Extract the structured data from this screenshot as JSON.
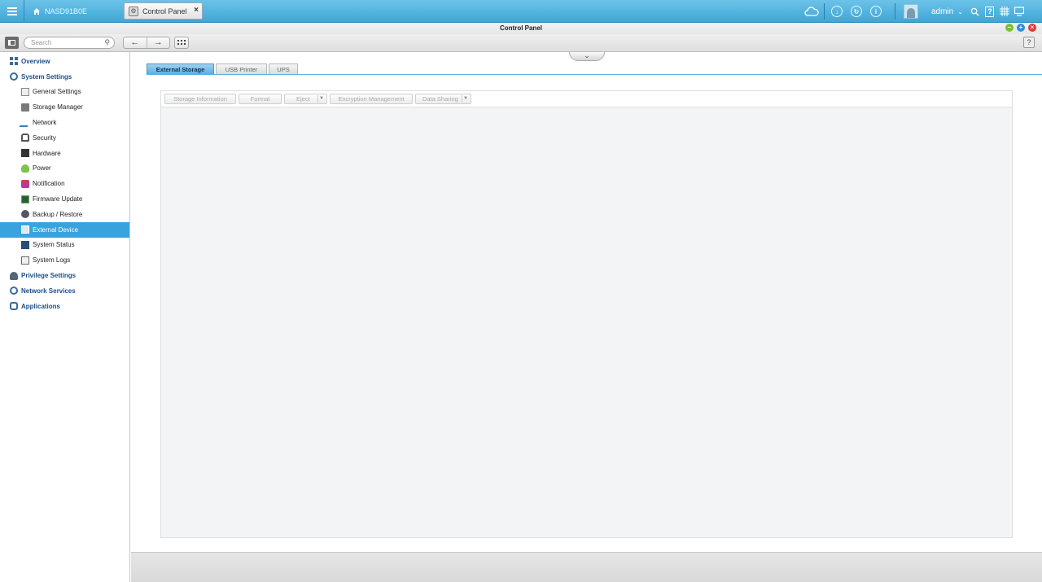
{
  "topbar": {
    "nas_name": "NASD91B0E",
    "app_tab_label": "Control Panel",
    "user_name": "admin",
    "icons": [
      "menu-icon",
      "home-icon",
      "cloud-icon",
      "download-icon",
      "sync-icon",
      "info-icon",
      "avatar-icon",
      "search-icon",
      "help-icon",
      "grid-icon",
      "monitor-icon"
    ]
  },
  "window": {
    "title": "Control Panel"
  },
  "toolbar": {
    "search_placeholder": "Search",
    "back_glyph": "←",
    "forward_glyph": "→"
  },
  "sidebar": {
    "items": [
      {
        "label": "Overview",
        "level": "top"
      },
      {
        "label": "System Settings",
        "level": "top"
      },
      {
        "label": "General Settings",
        "level": "sub"
      },
      {
        "label": "Storage Manager",
        "level": "sub"
      },
      {
        "label": "Network",
        "level": "sub"
      },
      {
        "label": "Security",
        "level": "sub"
      },
      {
        "label": "Hardware",
        "level": "sub"
      },
      {
        "label": "Power",
        "level": "sub"
      },
      {
        "label": "Notification",
        "level": "sub"
      },
      {
        "label": "Firmware Update",
        "level": "sub"
      },
      {
        "label": "Backup / Restore",
        "level": "sub"
      },
      {
        "label": "External Device",
        "level": "sub",
        "active": true
      },
      {
        "label": "System Status",
        "level": "sub"
      },
      {
        "label": "System Logs",
        "level": "sub"
      },
      {
        "label": "Privilege Settings",
        "level": "top"
      },
      {
        "label": "Network Services",
        "level": "top"
      },
      {
        "label": "Applications",
        "level": "top"
      }
    ]
  },
  "main": {
    "tabs": [
      {
        "label": "External Storage",
        "active": true
      },
      {
        "label": "USB Printer",
        "active": false
      },
      {
        "label": "UPS",
        "active": false
      }
    ],
    "actions": {
      "storage_information": "Storage Information",
      "format": "Format",
      "eject": "Eject",
      "encryption_management": "Encryption Management",
      "data_sharing": "Data Sharing"
    }
  },
  "colors": {
    "topbar": "#3fa6d6",
    "active_item": "#3aa3dd",
    "minimize": "#7cbf3a",
    "maximize": "#2f8fd3",
    "close": "#e53935"
  }
}
